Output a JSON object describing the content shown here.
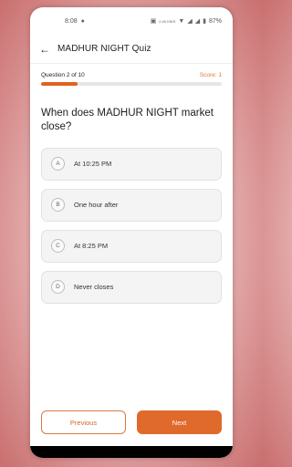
{
  "status_bar": {
    "time": "8:08",
    "network_speed": "0.00 KB/S",
    "battery": "87%"
  },
  "app_bar": {
    "title": "MADHUR NIGHT  Quiz"
  },
  "progress": {
    "question_count": "Question 2 of 10",
    "score": "Score: 1",
    "fraction": 0.2
  },
  "question": "When does MADHUR NIGHT  market close?",
  "options": [
    {
      "letter": "A",
      "text": "At 10:25 PM"
    },
    {
      "letter": "B",
      "text": "One hour after"
    },
    {
      "letter": "C",
      "text": "At 8:25 PM"
    },
    {
      "letter": "D",
      "text": "Never closes"
    }
  ],
  "footer": {
    "previous_label": "Previous",
    "next_label": "Next"
  },
  "colors": {
    "accent": "#e0631e",
    "score": "#e0773a"
  }
}
